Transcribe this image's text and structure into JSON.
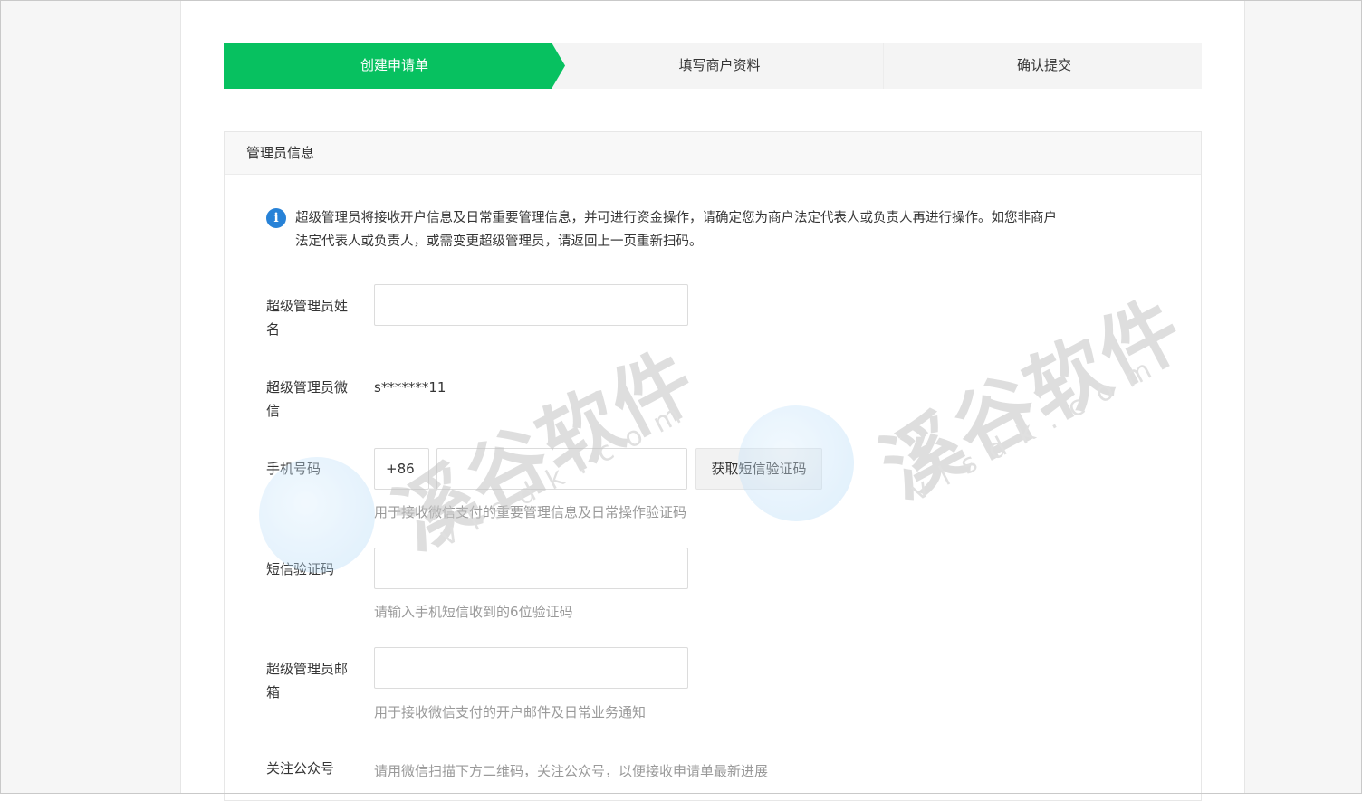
{
  "steps": [
    {
      "label": "创建申请单",
      "active": true
    },
    {
      "label": "填写商户资料",
      "active": false
    },
    {
      "label": "确认提交",
      "active": false
    }
  ],
  "colors": {
    "accent": "#07c160",
    "info": "#2782d7",
    "hint": "#9a9a9a"
  },
  "panel": {
    "title": "管理员信息",
    "notice_icon": "info-icon",
    "notice_line1": "超级管理员将接收开户信息及日常重要管理信息，并可进行资金操作，请确定您为商户法定代表人或负责人再进行操作。如您非商户",
    "notice_line2": "法定代表人或负责人，或需变更超级管理员，请返回上一页重新扫码。"
  },
  "form": {
    "name_label_1": "超级管理员姓",
    "name_label_2": "名",
    "name_value": "",
    "wechat_label_1": "超级管理员微",
    "wechat_label_2": "信",
    "wechat_value": "s*******11",
    "phone_label": "手机号码",
    "phone_prefix": "+86",
    "phone_value": "",
    "sms_button": "获取短信验证码",
    "phone_hint": "用于接收微信支付的重要管理信息及日常操作验证码",
    "code_label": "短信验证码",
    "code_value": "",
    "code_hint": "请输入手机短信收到的6位验证码",
    "email_label_1": "超级管理员邮",
    "email_label_2": "箱",
    "email_value": "",
    "email_hint": "用于接收微信支付的开户邮件及日常业务通知",
    "follow_label": "关注公众号",
    "follow_hint": "请用微信扫描下方二维码，关注公众号，以便接收申请单最新进展"
  },
  "watermark": {
    "text": "溪谷软件",
    "sub": "vlsdk.com"
  }
}
